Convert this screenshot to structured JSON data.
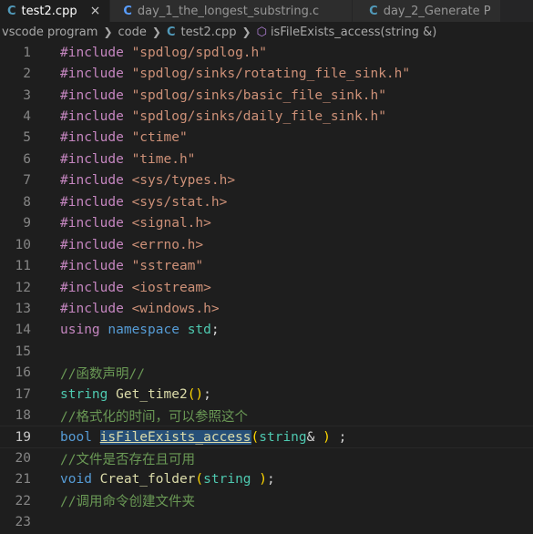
{
  "tabs": [
    {
      "icon": "C",
      "label": "test2.cpp",
      "active": true,
      "close": "×"
    },
    {
      "icon": "C",
      "label": "day_1_the_longest_substring.c",
      "active": false
    },
    {
      "icon": "C",
      "label": "day_2_Generate P",
      "active": false
    }
  ],
  "breadcrumb": {
    "folder1": "vscode program",
    "folder2": "code",
    "file": "test2.cpp",
    "symbol": "isFileExists_access(string &)"
  },
  "code_lines": [
    {
      "n": "1",
      "parts": [
        [
          "#include",
          "kw-pp"
        ],
        [
          " ",
          "punc"
        ],
        [
          "\"spdlog/spdlog.h\"",
          "str"
        ]
      ]
    },
    {
      "n": "2",
      "parts": [
        [
          "#include",
          "kw-pp"
        ],
        [
          " ",
          "punc"
        ],
        [
          "\"spdlog/sinks/rotating_file_sink.h\"",
          "str"
        ]
      ]
    },
    {
      "n": "3",
      "parts": [
        [
          "#include",
          "kw-pp"
        ],
        [
          " ",
          "punc"
        ],
        [
          "\"spdlog/sinks/basic_file_sink.h\"",
          "str"
        ]
      ]
    },
    {
      "n": "4",
      "parts": [
        [
          "#include",
          "kw-pp"
        ],
        [
          " ",
          "punc"
        ],
        [
          "\"spdlog/sinks/daily_file_sink.h\"",
          "str"
        ]
      ]
    },
    {
      "n": "5",
      "parts": [
        [
          "#include",
          "kw-pp"
        ],
        [
          " ",
          "punc"
        ],
        [
          "\"ctime\"",
          "str"
        ]
      ]
    },
    {
      "n": "6",
      "parts": [
        [
          "#include",
          "kw-pp"
        ],
        [
          " ",
          "punc"
        ],
        [
          "\"time.h\"",
          "str"
        ]
      ]
    },
    {
      "n": "7",
      "parts": [
        [
          "#include",
          "kw-pp"
        ],
        [
          " ",
          "punc"
        ],
        [
          "<sys/types.h>",
          "str"
        ]
      ]
    },
    {
      "n": "8",
      "parts": [
        [
          "#include",
          "kw-pp"
        ],
        [
          " ",
          "punc"
        ],
        [
          "<sys/stat.h>",
          "str"
        ]
      ]
    },
    {
      "n": "9",
      "parts": [
        [
          "#include",
          "kw-pp"
        ],
        [
          " ",
          "punc"
        ],
        [
          "<signal.h>",
          "str"
        ]
      ]
    },
    {
      "n": "10",
      "parts": [
        [
          "#include",
          "kw-pp"
        ],
        [
          " ",
          "punc"
        ],
        [
          "<errno.h>",
          "str"
        ]
      ]
    },
    {
      "n": "11",
      "parts": [
        [
          "#include",
          "kw-pp"
        ],
        [
          " ",
          "punc"
        ],
        [
          "\"sstream\"",
          "str"
        ]
      ]
    },
    {
      "n": "12",
      "parts": [
        [
          "#include",
          "kw-pp"
        ],
        [
          " ",
          "punc"
        ],
        [
          "<iostream>",
          "str"
        ]
      ]
    },
    {
      "n": "13",
      "parts": [
        [
          "#include",
          "kw-pp"
        ],
        [
          " ",
          "punc"
        ],
        [
          "<windows.h>",
          "str"
        ]
      ]
    },
    {
      "n": "14",
      "parts": [
        [
          "using",
          "kw-pp"
        ],
        [
          " ",
          "punc"
        ],
        [
          "namespace",
          "kw"
        ],
        [
          " ",
          "punc"
        ],
        [
          "std",
          "ns"
        ],
        [
          ";",
          "punc"
        ]
      ]
    },
    {
      "n": "15",
      "parts": []
    },
    {
      "n": "16",
      "parts": [
        [
          "//函数声明//",
          "cm"
        ]
      ]
    },
    {
      "n": "17",
      "parts": [
        [
          "string",
          "type"
        ],
        [
          " ",
          "punc"
        ],
        [
          "Get_time2",
          "fn"
        ],
        [
          "()",
          "br1"
        ],
        [
          ";",
          "punc"
        ]
      ]
    },
    {
      "n": "18",
      "parts": [
        [
          "//格式化的时间，可以参照这个",
          "cm"
        ]
      ]
    },
    {
      "n": "19",
      "current": true,
      "parts": [
        [
          "bool",
          "kw"
        ],
        [
          " ",
          "punc"
        ],
        [
          "isFileExists_access",
          "hl"
        ],
        [
          "(",
          "br1"
        ],
        [
          "string",
          "type"
        ],
        [
          "&",
          "punc"
        ],
        [
          " ",
          "punc"
        ],
        [
          ")",
          "br1"
        ],
        [
          " ;",
          "punc"
        ]
      ]
    },
    {
      "n": "20",
      "parts": [
        [
          "//文件是否存在且可用",
          "cm"
        ]
      ]
    },
    {
      "n": "21",
      "parts": [
        [
          "void",
          "kw"
        ],
        [
          " ",
          "punc"
        ],
        [
          "Creat_folder",
          "fn"
        ],
        [
          "(",
          "br1"
        ],
        [
          "string",
          "type"
        ],
        [
          " ",
          "punc"
        ],
        [
          ")",
          "br1"
        ],
        [
          ";",
          "punc"
        ]
      ]
    },
    {
      "n": "22",
      "parts": [
        [
          "//调用命令创建文件夹",
          "cm"
        ]
      ]
    },
    {
      "n": "23",
      "parts": []
    }
  ]
}
